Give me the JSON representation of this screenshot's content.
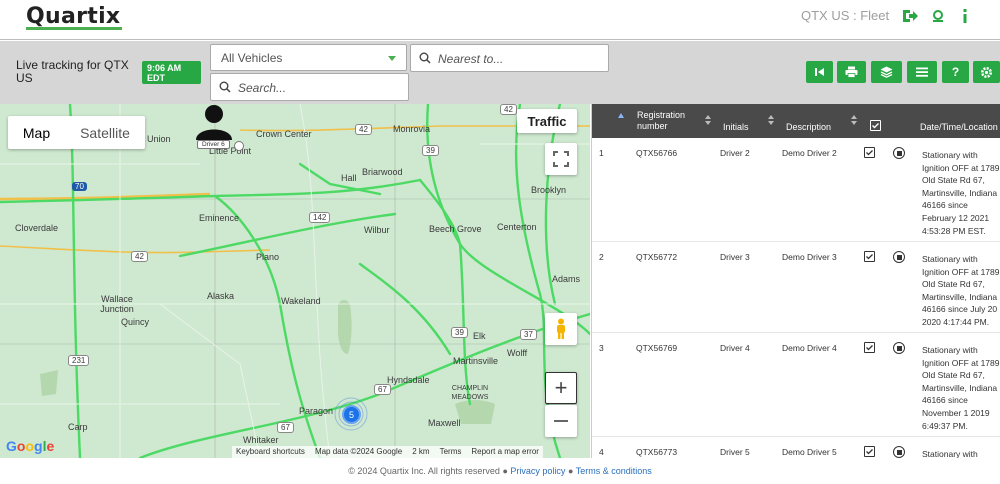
{
  "header": {
    "logo": "Quartix",
    "fleet_name": "QTX US : Fleet",
    "icons": [
      "sign-out-icon",
      "account-icon",
      "info-icon"
    ]
  },
  "toolbar": {
    "live_label": "Live tracking for QTX US",
    "time_badge": "9:06 AM EDT",
    "vehicle_select": "All Vehicles",
    "nearest_placeholder": "Nearest to...",
    "search_placeholder": "Search...",
    "buttons": [
      "first-icon",
      "print-icon",
      "layers-icon",
      "menu-icon",
      "help-icon",
      "settings-icon"
    ],
    "help_label": "?"
  },
  "map": {
    "type_map": "Map",
    "type_satellite": "Satellite",
    "traffic": "Traffic",
    "driver_label": "Driver 6",
    "cluster_count": "5",
    "places": [
      "Union",
      "Crown Center",
      "Monrovia",
      "Little Point",
      "Hall",
      "Briarwood",
      "Brooklyn",
      "Eminence",
      "Cloverdale",
      "Wilbur",
      "Beech Grove",
      "Centerton",
      "Plano",
      "Wallace Junction",
      "Alaska",
      "Wakeland",
      "Quincy",
      "Adams",
      "Elk",
      "Martinsville",
      "Wolff",
      "Hyndsdale",
      "CHAMPLIN MEADOWS",
      "Paragon",
      "Carp",
      "Maxwell",
      "Whitaker"
    ],
    "shields": [
      "42",
      "42",
      "39",
      "70",
      "142",
      "42",
      "39",
      "231",
      "67",
      "67",
      "37"
    ],
    "attribution": [
      "Keyboard shortcuts",
      "Map data ©2024 Google",
      "2 km",
      "Terms",
      "Report a map error"
    ],
    "google": "Google"
  },
  "table": {
    "columns": [
      "Registration number",
      "Initials",
      "Description",
      "Date/Time/Location"
    ],
    "rows": [
      {
        "num": "1",
        "reg": "QTX56766",
        "initials": "Driver 2",
        "desc": "Demo Driver 2",
        "location": "Stationary with Ignition OFF at 1789 Old State Rd 67, Martinsville, Indiana 46166 since February 12 2021 4:53:28 PM EST."
      },
      {
        "num": "2",
        "reg": "QTX56772",
        "initials": "Driver 3",
        "desc": "Demo Driver 3",
        "location": "Stationary with Ignition OFF at 1789 Old State Rd 67, Martinsville, Indiana 46166 since July 20 2020 4:17:44 PM."
      },
      {
        "num": "3",
        "reg": "QTX56769",
        "initials": "Driver 4",
        "desc": "Demo Driver 4",
        "location": "Stationary with Ignition OFF at 1789 Old State Rd 67, Martinsville, Indiana 46166 since November 1 2019 6:49:37 PM."
      },
      {
        "num": "4",
        "reg": "QTX56773",
        "initials": "Driver 5",
        "desc": "Demo Driver 5",
        "location": "Stationary with"
      }
    ]
  },
  "footer": {
    "copyright": "© 2024 Quartix Inc. All rights reserved",
    "privacy": "Privacy policy",
    "terms": "Terms & conditions"
  },
  "colors": {
    "accent": "#28a745",
    "header_dark": "#4a4a4a",
    "map_bg": "#cfe8d0",
    "road": "#4cd964",
    "highway": "#f0c04a"
  }
}
